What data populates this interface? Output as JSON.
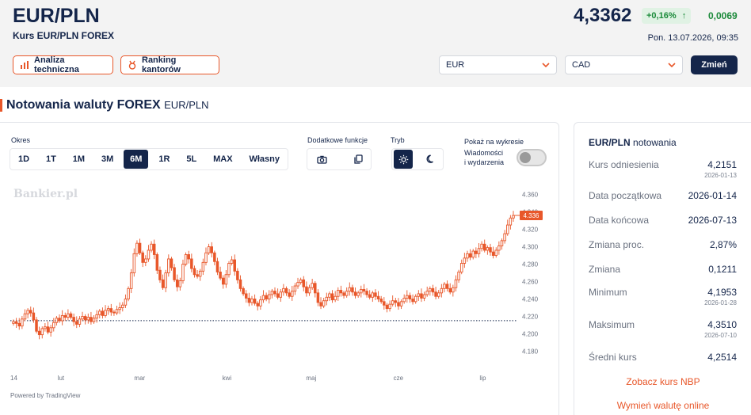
{
  "header": {
    "pair": "EUR/PLN",
    "subtitle": "Kurs EUR/PLN FOREX",
    "price": "4,3362",
    "change_pct": "+0,16%",
    "change_abs": "0,0069",
    "timestamp": "Pon. 13.07.2026, 09:35",
    "analysis_btn": "Analiza techniczna",
    "ranking_btn": "Ranking kantorów",
    "select_from": "EUR",
    "select_to": "CAD",
    "change_btn": "Zmień"
  },
  "section": {
    "title": "Notowania waluty FOREX",
    "subtitle": "EUR/PLN"
  },
  "controls": {
    "period_label": "Okres",
    "periods": [
      "1D",
      "1T",
      "1M",
      "3M",
      "6M",
      "1R",
      "5L",
      "MAX",
      "Własny"
    ],
    "active_period": "6M",
    "extra_label": "Dodatkowe funkcje",
    "mode_label": "Tryb",
    "show_label": "Pokaż na wykresie",
    "show_sub1": "Wiadomości",
    "show_sub2": "i wydarzenia"
  },
  "chart_data": {
    "type": "candlestick",
    "watermark": "Bankier.pl",
    "credit": "Powered by TradingView",
    "y_ticks": [
      4.36,
      4.34,
      4.32,
      4.3,
      4.28,
      4.26,
      4.24,
      4.22,
      4.2,
      4.18
    ],
    "y_tick_labels": [
      "4.360",
      "4.340",
      "4.320",
      "4.300",
      "4.280",
      "4.260",
      "4.240",
      "4.220",
      "4.200",
      "4.180"
    ],
    "ylim": [
      4.175,
      4.366
    ],
    "x_labels": [
      "14",
      "lut",
      "mar",
      "kwi",
      "maj",
      "cze",
      "lip"
    ],
    "x_label_days": [
      0,
      18,
      46,
      77,
      107,
      138,
      168
    ],
    "x_range_days": [
      0,
      180
    ],
    "last_price": 4.336,
    "last_price_label": "4.336",
    "baseline": 4.2151,
    "closes": [
      4.214,
      4.212,
      4.209,
      4.217,
      4.223,
      4.227,
      4.224,
      4.216,
      4.203,
      4.199,
      4.206,
      4.208,
      4.202,
      4.207,
      4.213,
      4.218,
      4.215,
      4.221,
      4.219,
      4.223,
      4.219,
      4.214,
      4.211,
      4.217,
      4.22,
      4.216,
      4.219,
      4.214,
      4.218,
      4.222,
      4.226,
      4.221,
      4.227,
      4.229,
      4.225,
      4.224,
      4.228,
      4.23,
      4.233,
      4.24,
      4.252,
      4.27,
      4.292,
      4.304,
      4.293,
      4.282,
      4.286,
      4.296,
      4.303,
      4.291,
      4.273,
      4.262,
      4.253,
      4.27,
      4.286,
      4.276,
      4.262,
      4.254,
      4.261,
      4.28,
      4.291,
      4.286,
      4.275,
      4.268,
      4.266,
      4.272,
      4.282,
      4.293,
      4.3,
      4.293,
      4.283,
      4.271,
      4.264,
      4.257,
      4.268,
      4.281,
      4.285,
      4.272,
      4.262,
      4.252,
      4.246,
      4.241,
      4.236,
      4.24,
      4.235,
      4.232,
      4.239,
      4.244,
      4.24,
      4.245,
      4.249,
      4.246,
      4.242,
      4.248,
      4.252,
      4.247,
      4.243,
      4.249,
      4.255,
      4.259,
      4.262,
      4.254,
      4.247,
      4.253,
      4.258,
      4.247,
      4.236,
      4.232,
      4.238,
      4.242,
      4.246,
      4.239,
      4.243,
      4.25,
      4.247,
      4.244,
      4.249,
      4.253,
      4.248,
      4.244,
      4.247,
      4.251,
      4.249,
      4.245,
      4.242,
      4.247,
      4.243,
      4.24,
      4.237,
      4.233,
      4.229,
      4.234,
      4.238,
      4.236,
      4.232,
      4.237,
      4.241,
      4.244,
      4.24,
      4.237,
      4.243,
      4.246,
      4.241,
      4.245,
      4.249,
      4.252,
      4.248,
      4.243,
      4.247,
      4.252,
      4.257,
      4.252,
      4.248,
      4.253,
      4.262,
      4.271,
      4.281,
      4.287,
      4.292,
      4.288,
      4.295,
      4.292,
      4.298,
      4.303,
      4.296,
      4.299,
      4.294,
      4.29,
      4.296,
      4.301,
      4.307,
      4.315,
      4.325,
      4.333,
      4.336
    ]
  },
  "info": {
    "title_pair": "EUR/PLN",
    "title_rest": "notowania",
    "rows": [
      {
        "label": "Kurs odniesienia",
        "value": "4,2151",
        "date": "2026-01-13"
      },
      {
        "label": "Data początkowa",
        "value": "2026-01-14",
        "date": ""
      },
      {
        "label": "Data końcowa",
        "value": "2026-07-13",
        "date": ""
      },
      {
        "label": "Zmiana proc.",
        "value": "2,87%",
        "date": ""
      },
      {
        "label": "Zmiana",
        "value": "0,1211",
        "date": ""
      },
      {
        "label": "Minimum",
        "value": "4,1953",
        "date": "2026-01-28"
      },
      {
        "label": "Maksimum",
        "value": "4,3510",
        "date": "2026-07-10"
      },
      {
        "label": "Średni kurs",
        "value": "4,2514",
        "date": ""
      }
    ],
    "link_nbp": "Zobacz kurs NBP",
    "link_exchange": "Wymień walutę online"
  },
  "colors": {
    "accent": "#e8572a",
    "navy": "#14254a",
    "up": "#1b8a3a",
    "candle_up": "#ffffff",
    "candle_down": "#e8572a"
  }
}
